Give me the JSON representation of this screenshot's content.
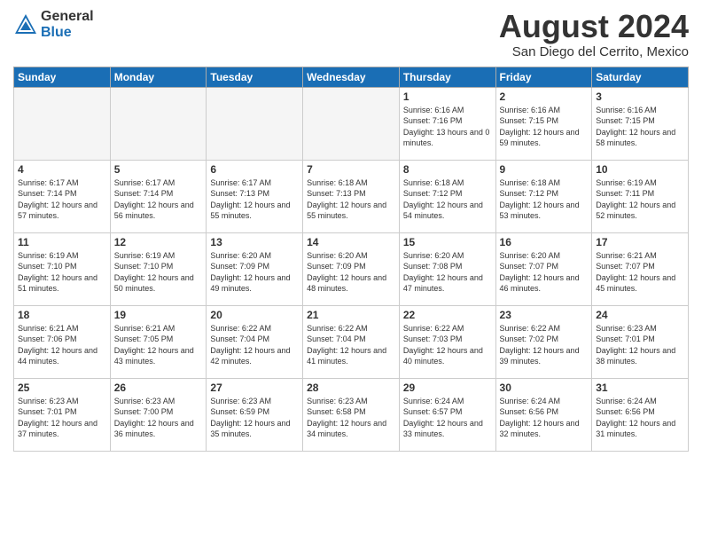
{
  "header": {
    "logo_general": "General",
    "logo_blue": "Blue",
    "month_title": "August 2024",
    "subtitle": "San Diego del Cerrito, Mexico"
  },
  "days_of_week": [
    "Sunday",
    "Monday",
    "Tuesday",
    "Wednesday",
    "Thursday",
    "Friday",
    "Saturday"
  ],
  "weeks": [
    [
      {
        "day": "",
        "empty": true
      },
      {
        "day": "",
        "empty": true
      },
      {
        "day": "",
        "empty": true
      },
      {
        "day": "",
        "empty": true
      },
      {
        "day": "1",
        "sunrise": "6:16 AM",
        "sunset": "7:16 PM",
        "daylight": "13 hours and 0 minutes."
      },
      {
        "day": "2",
        "sunrise": "6:16 AM",
        "sunset": "7:15 PM",
        "daylight": "12 hours and 59 minutes."
      },
      {
        "day": "3",
        "sunrise": "6:16 AM",
        "sunset": "7:15 PM",
        "daylight": "12 hours and 58 minutes."
      }
    ],
    [
      {
        "day": "4",
        "sunrise": "6:17 AM",
        "sunset": "7:14 PM",
        "daylight": "12 hours and 57 minutes."
      },
      {
        "day": "5",
        "sunrise": "6:17 AM",
        "sunset": "7:14 PM",
        "daylight": "12 hours and 56 minutes."
      },
      {
        "day": "6",
        "sunrise": "6:17 AM",
        "sunset": "7:13 PM",
        "daylight": "12 hours and 55 minutes."
      },
      {
        "day": "7",
        "sunrise": "6:18 AM",
        "sunset": "7:13 PM",
        "daylight": "12 hours and 55 minutes."
      },
      {
        "day": "8",
        "sunrise": "6:18 AM",
        "sunset": "7:12 PM",
        "daylight": "12 hours and 54 minutes."
      },
      {
        "day": "9",
        "sunrise": "6:18 AM",
        "sunset": "7:12 PM",
        "daylight": "12 hours and 53 minutes."
      },
      {
        "day": "10",
        "sunrise": "6:19 AM",
        "sunset": "7:11 PM",
        "daylight": "12 hours and 52 minutes."
      }
    ],
    [
      {
        "day": "11",
        "sunrise": "6:19 AM",
        "sunset": "7:10 PM",
        "daylight": "12 hours and 51 minutes."
      },
      {
        "day": "12",
        "sunrise": "6:19 AM",
        "sunset": "7:10 PM",
        "daylight": "12 hours and 50 minutes."
      },
      {
        "day": "13",
        "sunrise": "6:20 AM",
        "sunset": "7:09 PM",
        "daylight": "12 hours and 49 minutes."
      },
      {
        "day": "14",
        "sunrise": "6:20 AM",
        "sunset": "7:09 PM",
        "daylight": "12 hours and 48 minutes."
      },
      {
        "day": "15",
        "sunrise": "6:20 AM",
        "sunset": "7:08 PM",
        "daylight": "12 hours and 47 minutes."
      },
      {
        "day": "16",
        "sunrise": "6:20 AM",
        "sunset": "7:07 PM",
        "daylight": "12 hours and 46 minutes."
      },
      {
        "day": "17",
        "sunrise": "6:21 AM",
        "sunset": "7:07 PM",
        "daylight": "12 hours and 45 minutes."
      }
    ],
    [
      {
        "day": "18",
        "sunrise": "6:21 AM",
        "sunset": "7:06 PM",
        "daylight": "12 hours and 44 minutes."
      },
      {
        "day": "19",
        "sunrise": "6:21 AM",
        "sunset": "7:05 PM",
        "daylight": "12 hours and 43 minutes."
      },
      {
        "day": "20",
        "sunrise": "6:22 AM",
        "sunset": "7:04 PM",
        "daylight": "12 hours and 42 minutes."
      },
      {
        "day": "21",
        "sunrise": "6:22 AM",
        "sunset": "7:04 PM",
        "daylight": "12 hours and 41 minutes."
      },
      {
        "day": "22",
        "sunrise": "6:22 AM",
        "sunset": "7:03 PM",
        "daylight": "12 hours and 40 minutes."
      },
      {
        "day": "23",
        "sunrise": "6:22 AM",
        "sunset": "7:02 PM",
        "daylight": "12 hours and 39 minutes."
      },
      {
        "day": "24",
        "sunrise": "6:23 AM",
        "sunset": "7:01 PM",
        "daylight": "12 hours and 38 minutes."
      }
    ],
    [
      {
        "day": "25",
        "sunrise": "6:23 AM",
        "sunset": "7:01 PM",
        "daylight": "12 hours and 37 minutes."
      },
      {
        "day": "26",
        "sunrise": "6:23 AM",
        "sunset": "7:00 PM",
        "daylight": "12 hours and 36 minutes."
      },
      {
        "day": "27",
        "sunrise": "6:23 AM",
        "sunset": "6:59 PM",
        "daylight": "12 hours and 35 minutes."
      },
      {
        "day": "28",
        "sunrise": "6:23 AM",
        "sunset": "6:58 PM",
        "daylight": "12 hours and 34 minutes."
      },
      {
        "day": "29",
        "sunrise": "6:24 AM",
        "sunset": "6:57 PM",
        "daylight": "12 hours and 33 minutes."
      },
      {
        "day": "30",
        "sunrise": "6:24 AM",
        "sunset": "6:56 PM",
        "daylight": "12 hours and 32 minutes."
      },
      {
        "day": "31",
        "sunrise": "6:24 AM",
        "sunset": "6:56 PM",
        "daylight": "12 hours and 31 minutes."
      }
    ]
  ]
}
